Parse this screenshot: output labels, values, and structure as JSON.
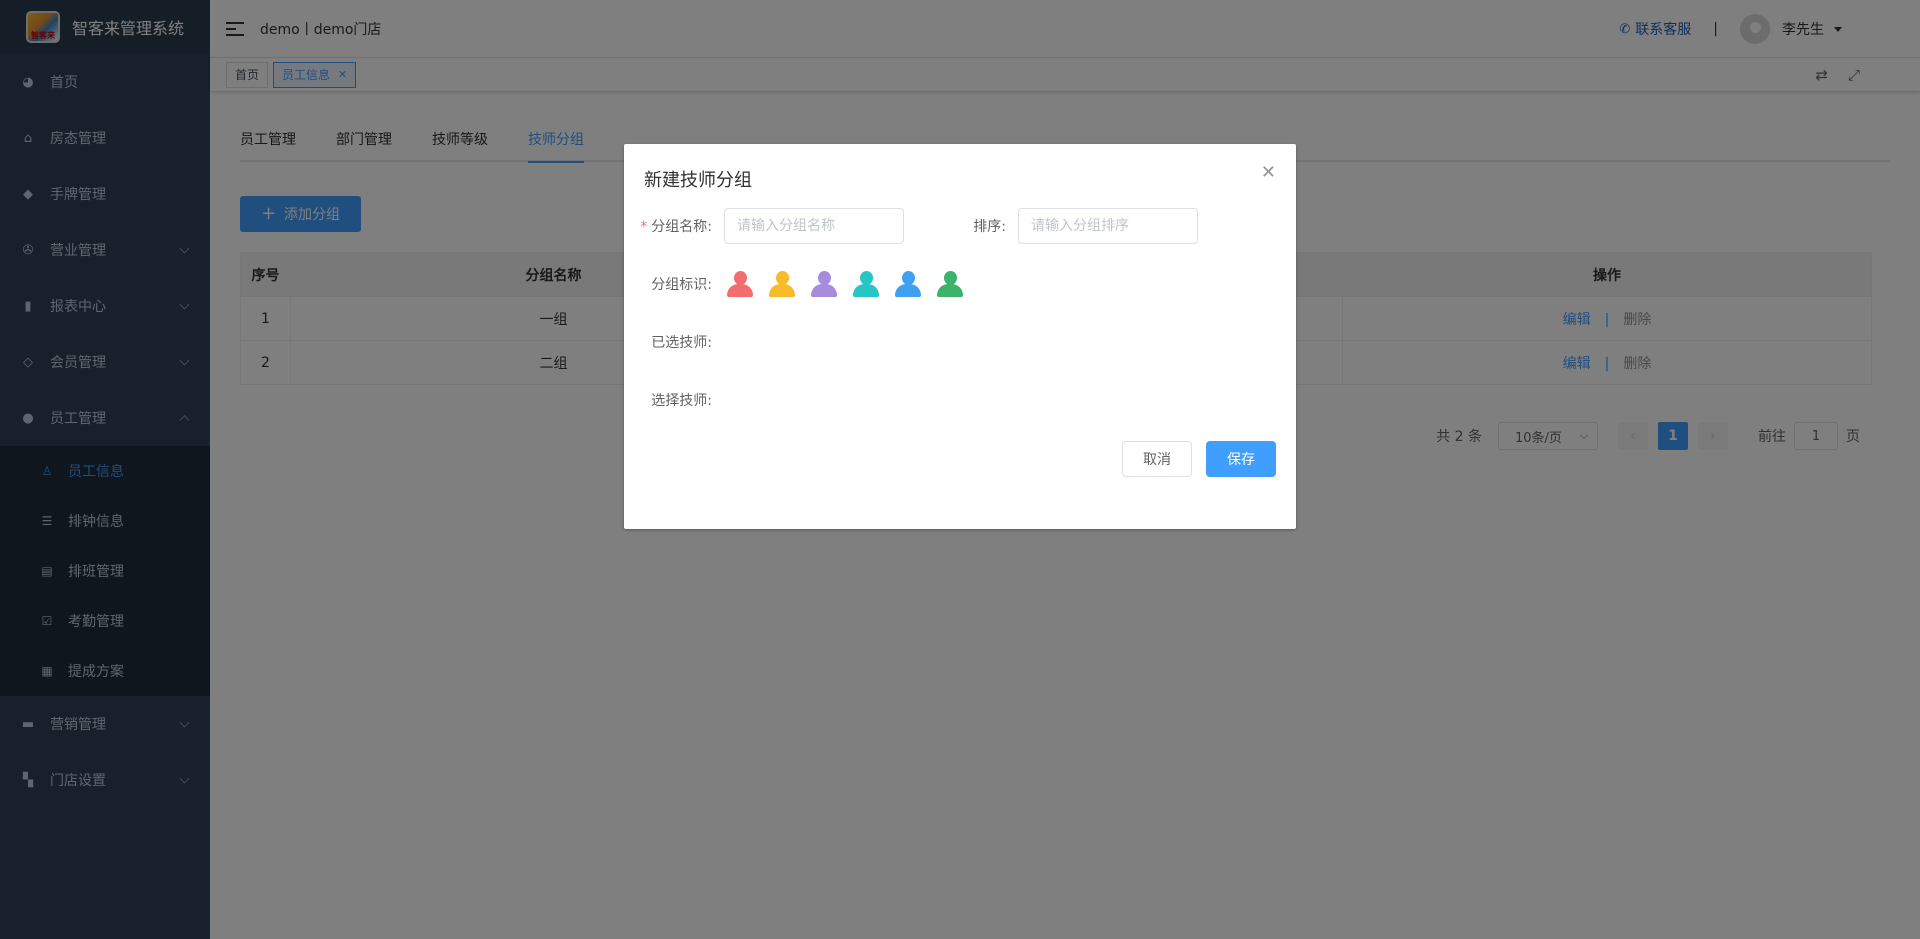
{
  "app": {
    "title": "智客来管理系统",
    "logo_text": "智客来"
  },
  "sidebar": {
    "items": [
      {
        "label": "首页",
        "icon": "dashboard-icon"
      },
      {
        "label": "房态管理",
        "icon": "home-icon"
      },
      {
        "label": "手牌管理",
        "icon": "tag-icon"
      },
      {
        "label": "营业管理",
        "icon": "aperture-icon"
      },
      {
        "label": "报表中心",
        "icon": "bar-chart-icon"
      },
      {
        "label": "会员管理",
        "icon": "diamond-icon"
      },
      {
        "label": "员工管理",
        "icon": "user-icon"
      },
      {
        "label": "营销管理",
        "icon": "briefcase-icon"
      },
      {
        "label": "门店设置",
        "icon": "grid-icon"
      }
    ],
    "subitems": [
      {
        "label": "员工信息",
        "icon": "person-outline-icon",
        "active": true
      },
      {
        "label": "排钟信息",
        "icon": "list-icon"
      },
      {
        "label": "排班管理",
        "icon": "schedule-icon"
      },
      {
        "label": "考勤管理",
        "icon": "clipboard-check-icon"
      },
      {
        "label": "提成方案",
        "icon": "table-icon"
      }
    ]
  },
  "navbar": {
    "store": "demo丨demo门店",
    "contact": "联系客服",
    "separator": "|",
    "user": "李先生"
  },
  "tags": {
    "home": "首页",
    "current": "员工信息"
  },
  "tabs": [
    "员工管理",
    "部门管理",
    "技师等级",
    "技师分组"
  ],
  "add_button": "添加分组",
  "table": {
    "headers": [
      "序号",
      "分组名称",
      "操作"
    ],
    "rows": [
      {
        "index": "1",
        "name": "一组"
      },
      {
        "index": "2",
        "name": "二组"
      }
    ],
    "edit": "编辑",
    "delete": "删除",
    "op_sep": "|"
  },
  "pagination": {
    "total": "共 2 条",
    "page_size": "10条/页",
    "current": "1",
    "goto_prefix": "前往",
    "goto_value": "1",
    "goto_suffix": "页"
  },
  "dialog": {
    "title": "新建技师分组",
    "name_label": "分组名称:",
    "name_placeholder": "请输入分组名称",
    "sort_label": "排序:",
    "sort_placeholder": "请输入分组排序",
    "mark_label": "分组标识:",
    "selected_label": "已选技师:",
    "choose_label": "选择技师:",
    "cancel": "取消",
    "save": "保存",
    "mark_colors": [
      "#f56c6c",
      "#f7ba2a",
      "#a78bde",
      "#26c6c6",
      "#3ea0f0",
      "#3bb36a"
    ]
  },
  "colors": {
    "sidebar_bg": "#304156",
    "accent": "#409eff"
  }
}
